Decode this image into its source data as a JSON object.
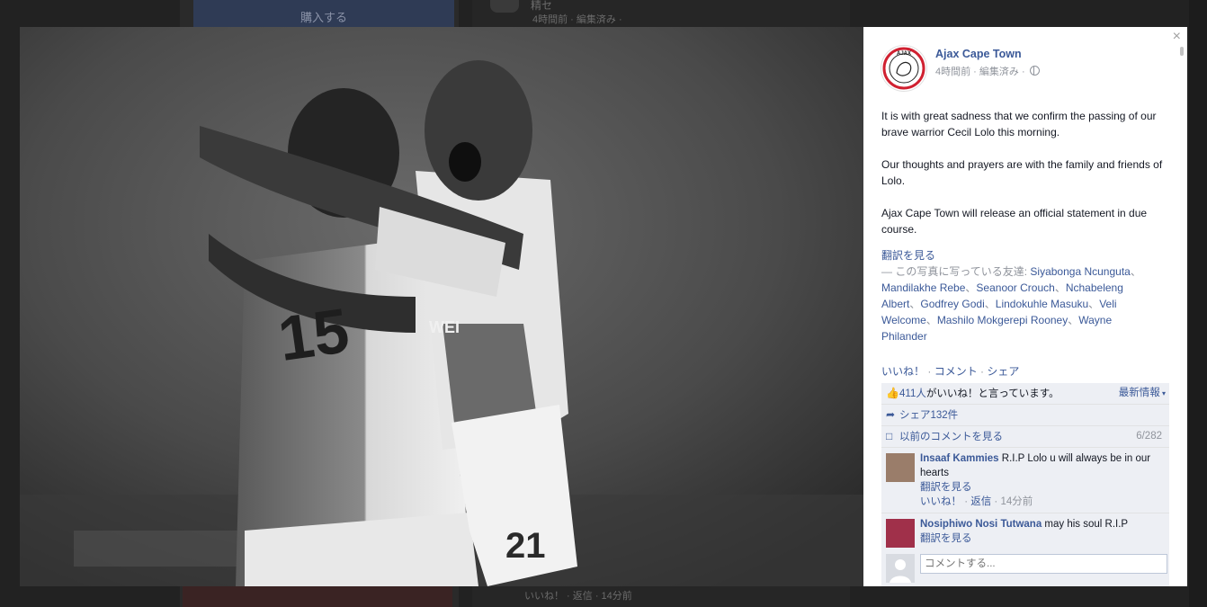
{
  "background": {
    "buy_button": "購入する",
    "item_title": "精セ",
    "item_meta": "4時間前 · 編集済み ·",
    "bottom_actions": "いいね！ · 返信 · 14分前"
  },
  "lightbox": {
    "close_symbol": "×",
    "page_name": "Ajax Cape Town",
    "post_time": "4時間前",
    "post_edited": " · 編集済み · ",
    "paragraphs": [
      "It is with great sadness that we confirm the passing of our brave warrior Cecil Lolo this morning.",
      "Our thoughts and prayers are with the family and friends of Lolo.",
      "Ajax Cape Town will release an official statement in due course."
    ],
    "translate": "翻訳を見る",
    "tags_prefix": "— この写真に写っている友達: ",
    "tagged": [
      "Siyabonga Ncunguta",
      "Mandilakhe Rebe",
      "Seanoor Crouch",
      "Nchabeleng Albert",
      "Godfrey Godi",
      "Lindokuhle Masuku",
      "Veli Welcome",
      "Mashilo Mokgerepi Rooney",
      "Wayne Philander"
    ],
    "tag_separator": "、",
    "actions": {
      "like": "いいね！",
      "comment": "コメント",
      "share": "シェア",
      "sep": " · "
    },
    "likes": {
      "count_link": "411人",
      "suffix": "がいいね！と言っています。",
      "sort": "最新情報"
    },
    "shares": "シェア132件",
    "prev_comments": {
      "label": "以前のコメントを見る",
      "count": "6/282"
    },
    "comments": [
      {
        "author": "Insaaf Kammies",
        "text": " R.I.P Lolo u will always be in our hearts",
        "translate": "翻訳を見る",
        "like": "いいね！",
        "reply": "返信",
        "time": "14分前"
      },
      {
        "author": "Nosiphiwo Nosi Tutwana",
        "text": " may his soul R.I.P",
        "translate": "翻訳を見る"
      }
    ],
    "comment_placeholder": "コメントする..."
  },
  "photo": {
    "jersey_number_left": "15",
    "jersey_number_right": "21",
    "sponsor_text": "WEI"
  },
  "logo": {
    "text": "AJAX",
    "sub": "CAPE TOWN"
  }
}
